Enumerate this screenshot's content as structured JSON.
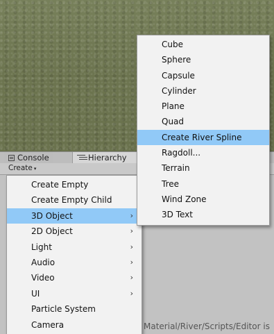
{
  "tabs": [
    {
      "label": "Console",
      "icon": "console-icon"
    },
    {
      "label": "Hierarchy",
      "icon": "hierarchy-icon"
    }
  ],
  "toolbar": {
    "create_label": "Create",
    "caret": "▾"
  },
  "status_text": "Material/River/Scripts/Editor is",
  "main_menu": [
    {
      "label": "Create Empty",
      "submenu": false
    },
    {
      "label": "Create Empty Child",
      "submenu": false
    },
    {
      "label": "3D Object",
      "submenu": true,
      "highlighted": true
    },
    {
      "label": "2D Object",
      "submenu": true
    },
    {
      "label": "Light",
      "submenu": true
    },
    {
      "label": "Audio",
      "submenu": true
    },
    {
      "label": "Video",
      "submenu": true
    },
    {
      "label": "UI",
      "submenu": true
    },
    {
      "label": "Particle System",
      "submenu": false
    },
    {
      "label": "Camera",
      "submenu": false
    }
  ],
  "sub_menu": [
    {
      "label": "Cube"
    },
    {
      "label": "Sphere"
    },
    {
      "label": "Capsule"
    },
    {
      "label": "Cylinder"
    },
    {
      "label": "Plane"
    },
    {
      "label": "Quad"
    },
    {
      "label": "Create River Spline",
      "highlighted": true
    },
    {
      "label": "Ragdoll..."
    },
    {
      "label": "Terrain"
    },
    {
      "label": "Tree"
    },
    {
      "label": "Wind Zone"
    },
    {
      "label": "3D Text"
    }
  ],
  "arrow_glyph": "›",
  "colors": {
    "highlight": "#91c9f7",
    "menu_bg": "#f2f2f2",
    "panel_bg": "#c2c2c2"
  }
}
